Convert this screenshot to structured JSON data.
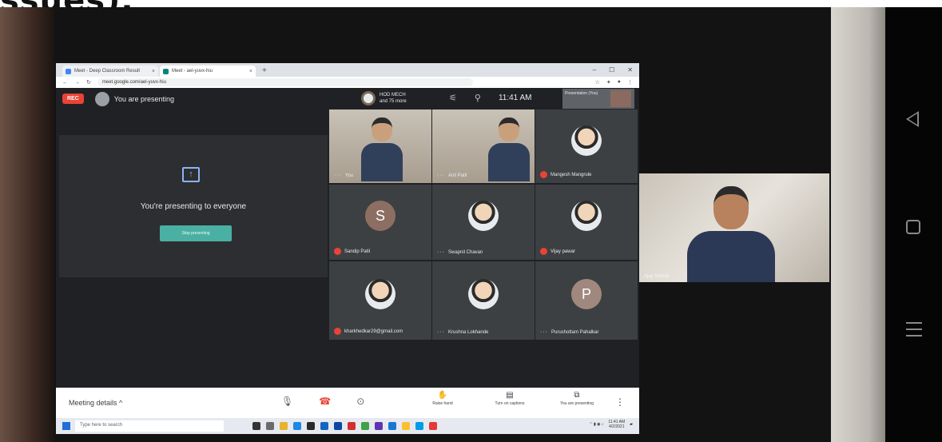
{
  "caption": "ssues).",
  "browser": {
    "tabs": [
      {
        "label": "Meet - Deep Classroom Result",
        "color": "#4285f4"
      },
      {
        "label": "Meet - ael-yuvx-hiu",
        "color": "#00897b"
      }
    ],
    "url": "meet.google.com/ael-yuvx-hiu"
  },
  "meet": {
    "rec_label": "REC",
    "presenting_label": "You are presenting",
    "hod_line1": "HOD MECH",
    "hod_line2": "and 75 more",
    "clock": "11:41 AM",
    "presentation_thumb": "Presentation (You)",
    "present_title": "You're presenting to everyone",
    "stop_label": "Stop presenting"
  },
  "participants": [
    {
      "name": "You",
      "type": "video",
      "mic": "on"
    },
    {
      "name": "Anil Patil",
      "type": "video",
      "mic": "on"
    },
    {
      "name": "Mangesh Mangrule",
      "type": "photo",
      "mic": "off"
    },
    {
      "name": "Sandip Patil",
      "type": "initial",
      "initial": "S",
      "color": "#8d6e63",
      "mic": "off"
    },
    {
      "name": "Swapnil Chavan",
      "type": "photo",
      "mic": "on"
    },
    {
      "name": "Vijay pawar",
      "type": "photo",
      "mic": "off"
    },
    {
      "name": "kharkhedkar29@gmail.com",
      "type": "photo",
      "mic": "off"
    },
    {
      "name": "Krushna Lokhande",
      "type": "photo",
      "mic": "on"
    },
    {
      "name": "Purushottam Pahalkar",
      "type": "initial",
      "initial": "P",
      "color": "#a1887f",
      "mic": "on"
    }
  ],
  "controls": {
    "meeting_details": "Meeting details ^",
    "raise_hand": "Raise hand",
    "captions": "Turn on captions",
    "present_now": "You are presenting"
  },
  "taskbar": {
    "search_placeholder": "Type here to search",
    "time": "11:41 AM",
    "date": "4/2/2021"
  },
  "selfview": {
    "name": "Ajay Shinde"
  }
}
